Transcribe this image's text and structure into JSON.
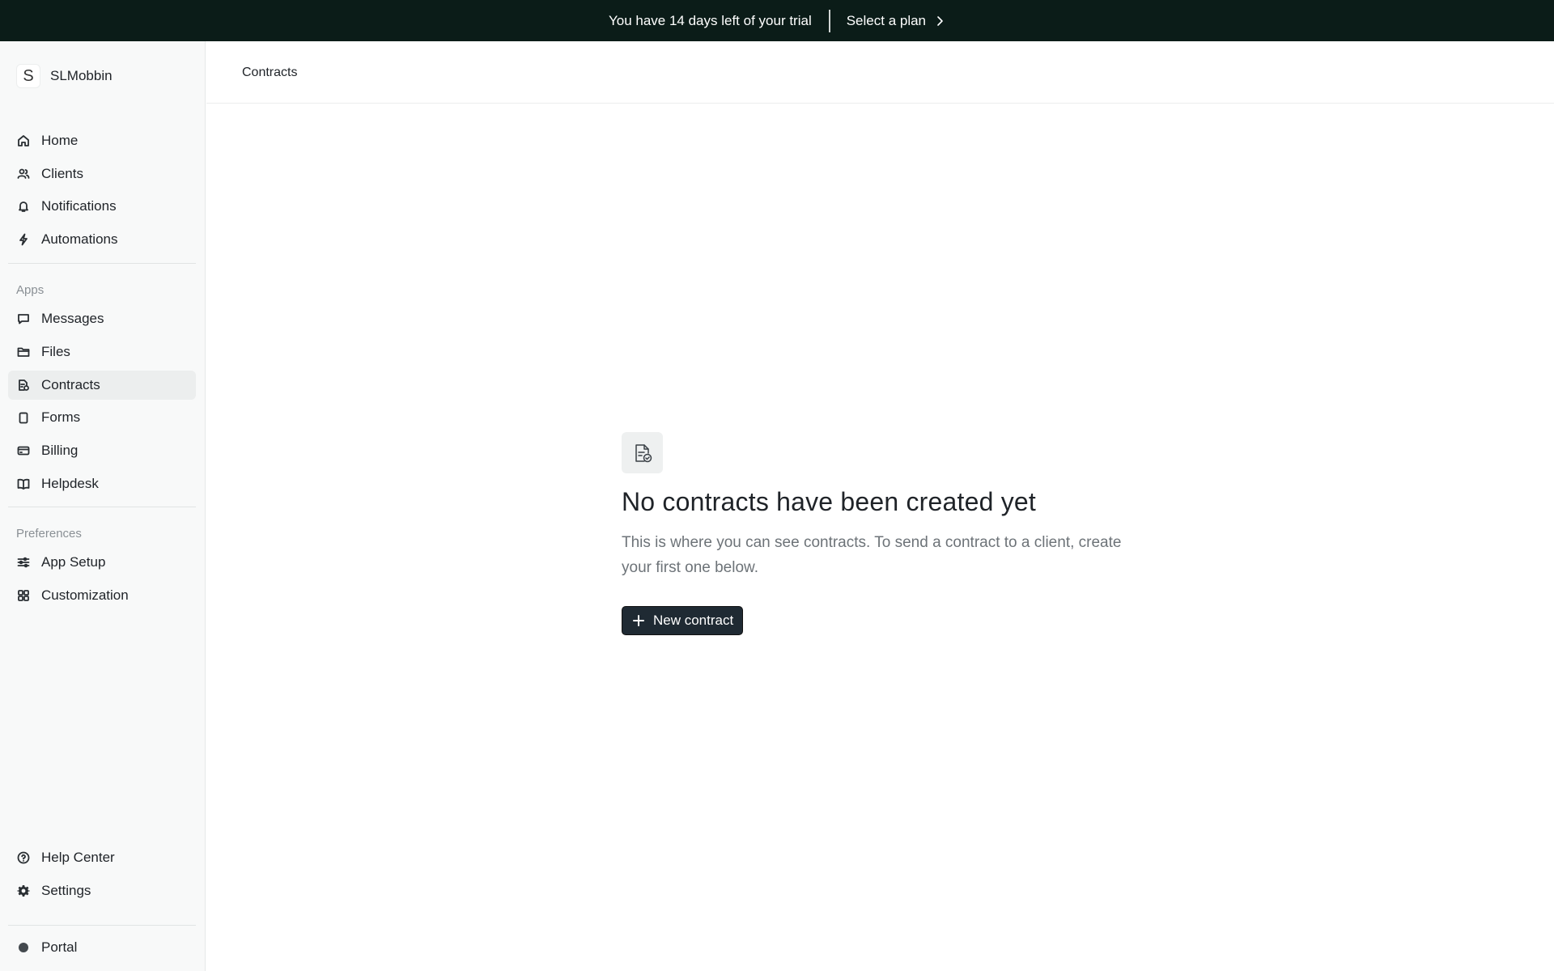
{
  "banner": {
    "trial_text": "You have 14 days left of your trial",
    "plan_label": "Select a plan"
  },
  "workspace": {
    "logo_letter": "S",
    "name": "SLMobbin"
  },
  "nav": {
    "main": [
      {
        "label": "Home",
        "icon": "home-icon"
      },
      {
        "label": "Clients",
        "icon": "users-icon"
      },
      {
        "label": "Notifications",
        "icon": "bell-icon"
      },
      {
        "label": "Automations",
        "icon": "bolt-icon"
      }
    ],
    "apps_label": "Apps",
    "apps": [
      {
        "label": "Messages",
        "icon": "message-icon"
      },
      {
        "label": "Files",
        "icon": "folder-icon"
      },
      {
        "label": "Contracts",
        "icon": "contract-icon",
        "active": true
      },
      {
        "label": "Forms",
        "icon": "clipboard-icon"
      },
      {
        "label": "Billing",
        "icon": "credit-card-icon"
      },
      {
        "label": "Helpdesk",
        "icon": "book-icon"
      }
    ],
    "preferences_label": "Preferences",
    "preferences": [
      {
        "label": "App Setup",
        "icon": "sliders-icon"
      },
      {
        "label": "Customization",
        "icon": "grid-icon"
      }
    ],
    "bottom": [
      {
        "label": "Help Center",
        "icon": "help-circle-icon"
      },
      {
        "label": "Settings",
        "icon": "gear-icon"
      }
    ],
    "portal": {
      "label": "Portal",
      "icon": "status-dot-icon"
    }
  },
  "header": {
    "title": "Contracts"
  },
  "empty_state": {
    "heading": "No contracts have been created yet",
    "description": "This is where you can see contracts. To send a contract to a client, create your first one below.",
    "button_label": "New contract"
  },
  "colors": {
    "banner_bg": "#0b1c18",
    "sidebar_bg": "#f8f9f9",
    "active_item_bg": "#eceeee",
    "button_bg": "#1f2a33"
  }
}
